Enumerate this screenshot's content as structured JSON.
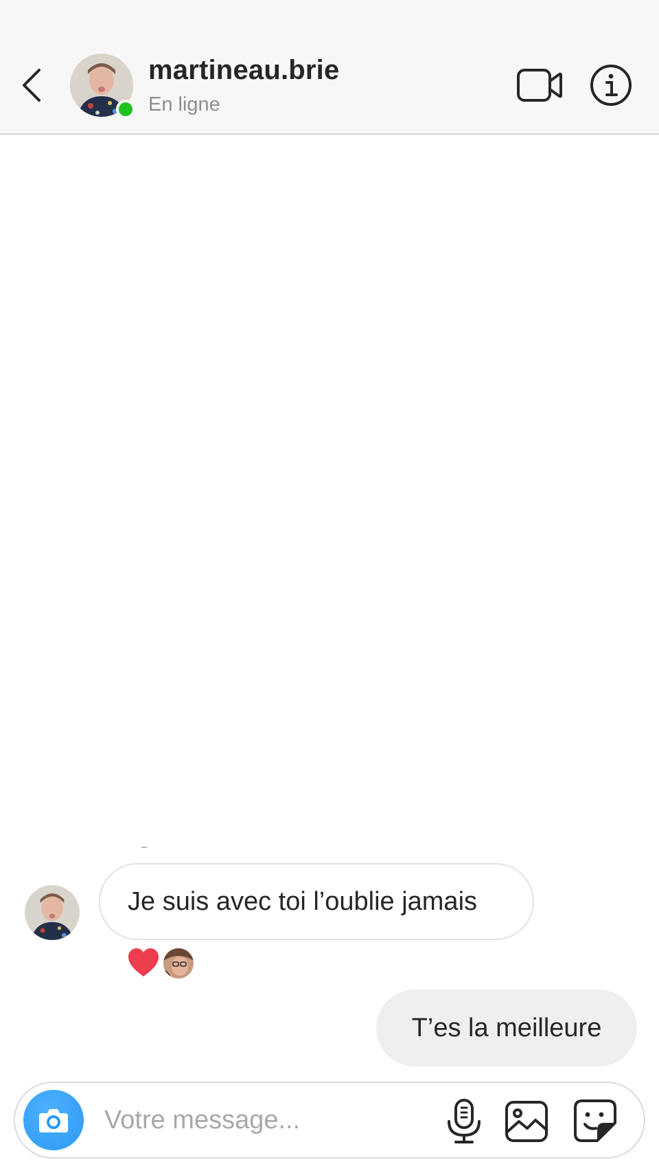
{
  "header": {
    "username": "martineau.brie",
    "status": "En ligne",
    "online_color": "#1ec21e"
  },
  "conversation": {
    "incoming": [
      {
        "text": "Je suis avec toi l’oublie jamais",
        "reactions": [
          "heart"
        ]
      }
    ],
    "outgoing": [
      {
        "text": "T’es la meilleure",
        "bubble_color": "#efefef"
      }
    ]
  },
  "composer": {
    "placeholder": "Votre message...",
    "camera_color": "#2b9af3",
    "icons": [
      "camera-icon",
      "microphone-icon",
      "gallery-icon",
      "sticker-icon"
    ]
  },
  "colors": {
    "heart": "#ed3d4f",
    "text": "#262626",
    "muted": "#8e8e8e"
  }
}
